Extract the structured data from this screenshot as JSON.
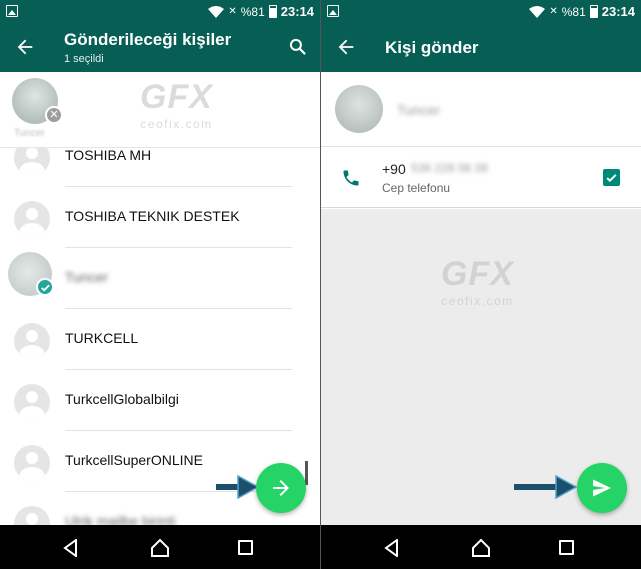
{
  "status": {
    "battery": "%81",
    "time": "23:14"
  },
  "left": {
    "title": "Gönderileceği kişiler",
    "subtitle": "1 seçildi",
    "selected_contact": {
      "name": "Tuncer"
    },
    "contacts": [
      {
        "name": "TOSHIBA MH",
        "selected": false
      },
      {
        "name": "TOSHIBA TEKNIK DESTEK",
        "selected": false
      },
      {
        "name": "Tuncer",
        "selected": true
      },
      {
        "name": "TURKCELL",
        "selected": false
      },
      {
        "name": "TurkcellGlobalbilgi",
        "selected": false
      },
      {
        "name": "TurkcellSuperONLINE",
        "selected": false
      },
      {
        "name": "Ulrik mailbe birinti",
        "selected": false
      }
    ]
  },
  "right": {
    "title": "Kişi gönder",
    "contact_name": "Tuncer",
    "phone_prefix": "+90",
    "phone_rest": "536 228 08 39",
    "phone_type": "Cep telefonu",
    "phone_checked": true
  },
  "watermark": {
    "logo": "GFX",
    "site": "ceofix.com"
  },
  "colors": {
    "primary_dark": "#075e54",
    "fab_green": "#25d366",
    "teal_check": "#00897b",
    "pointer_blue": "#1b4f6b"
  },
  "icons": [
    "back-arrow-icon",
    "search-icon",
    "arrow-right-icon",
    "send-icon",
    "phone-icon",
    "checkbox-icon",
    "nav-back-icon",
    "nav-home-icon",
    "nav-recents-icon"
  ]
}
